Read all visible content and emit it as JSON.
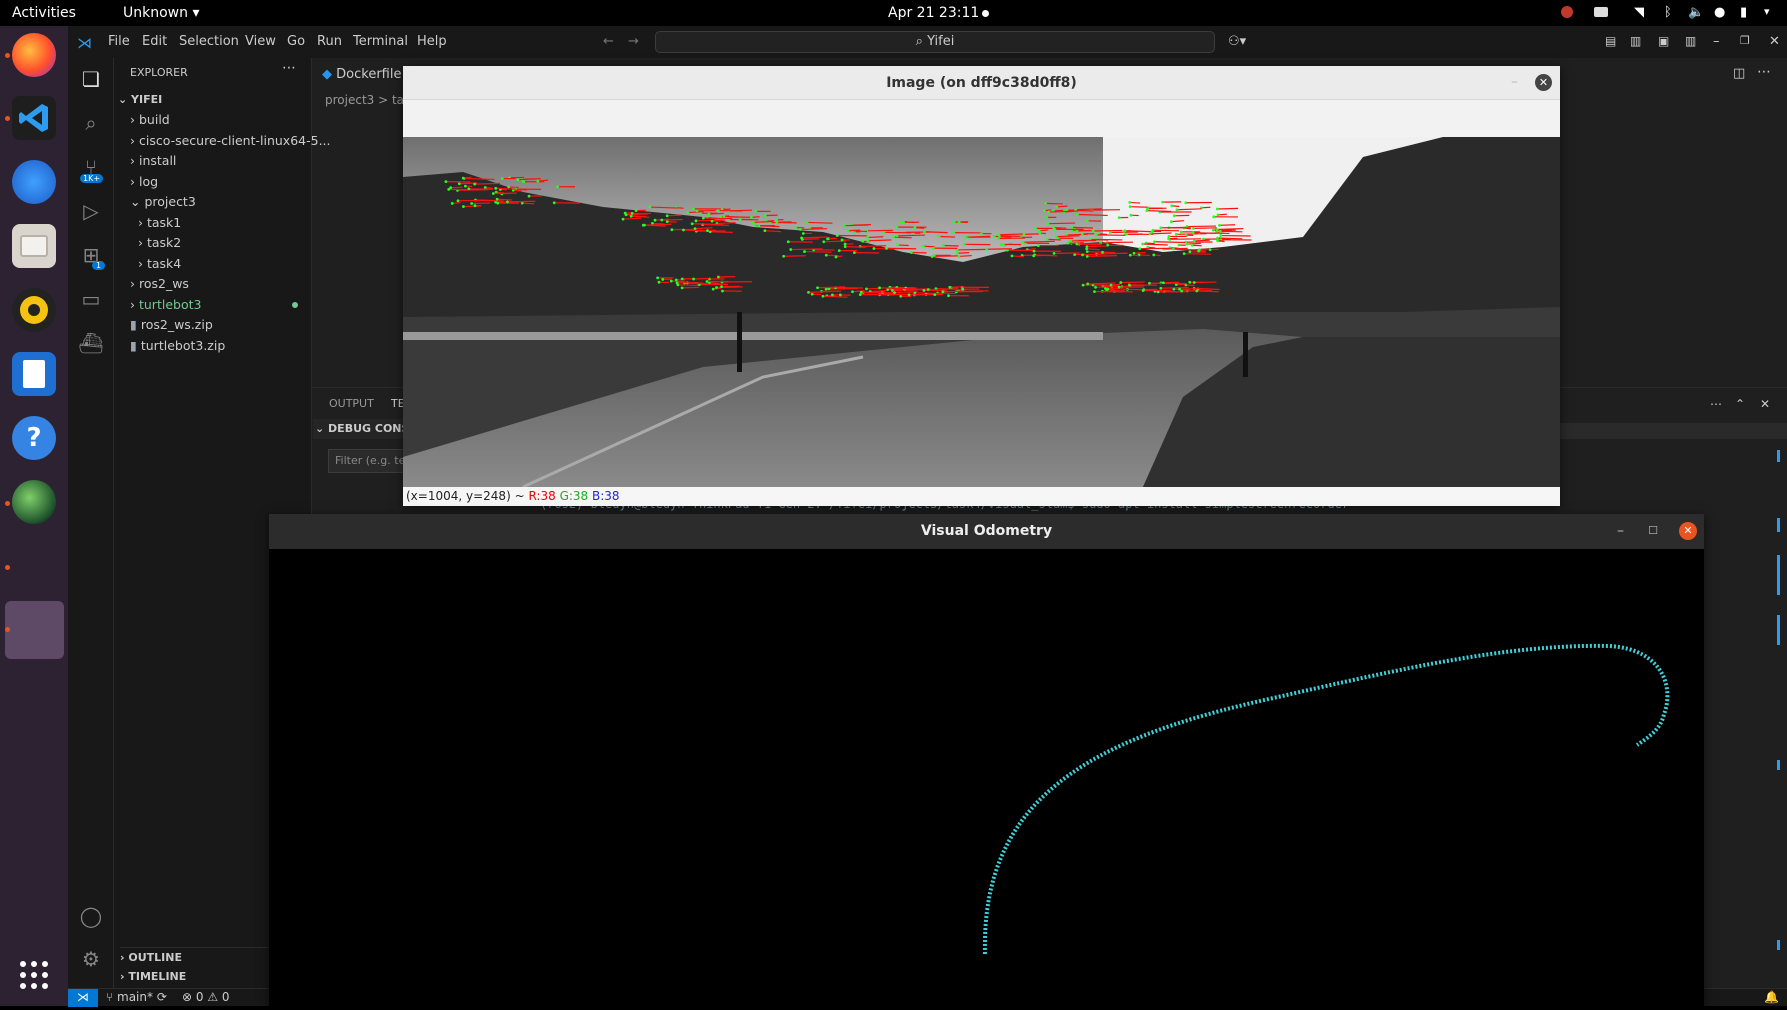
{
  "topbar": {
    "activities": "Activities",
    "app_menu": "Unknown",
    "clock": "Apr 21  23:11"
  },
  "vscode": {
    "menu": [
      "File",
      "Edit",
      "Selection",
      "View",
      "Go",
      "Run",
      "Terminal",
      "Help"
    ],
    "search": "Yifei",
    "explorer_title": "EXPLORER",
    "workspace": "YIFEI",
    "tree": [
      {
        "label": "build",
        "type": "folder",
        "indent": 1
      },
      {
        "label": "cisco-secure-client-linux64-5...",
        "type": "folder",
        "indent": 1
      },
      {
        "label": "install",
        "type": "folder",
        "indent": 1
      },
      {
        "label": "log",
        "type": "folder",
        "indent": 1
      },
      {
        "label": "project3",
        "type": "folder-open",
        "indent": 1
      },
      {
        "label": "task1",
        "type": "folder",
        "indent": 2
      },
      {
        "label": "task2",
        "type": "folder",
        "indent": 2
      },
      {
        "label": "task4",
        "type": "folder",
        "indent": 2
      },
      {
        "label": "ros2_ws",
        "type": "folder",
        "indent": 1
      },
      {
        "label": "turtlebot3",
        "type": "folder",
        "indent": 1,
        "modified": true
      },
      {
        "label": "ros2_ws.zip",
        "type": "file",
        "indent": 1
      },
      {
        "label": "turtlebot3.zip",
        "type": "file",
        "indent": 1
      }
    ],
    "editor_tab": "Dockerfile",
    "breadcrumb": "project3 > ta",
    "panel_tabs": [
      "OUTPUT",
      "TE"
    ],
    "debug_console": "DEBUG CONSO",
    "filter_placeholder": "Filter (e.g. te",
    "terminal_line": "(ros2) bledyn@bledyn-ThinkPad-T1-Gen-2:~/Yifei/project3/task4/visual_slam$ sudo apt install simplescreenrecorder",
    "outline": "OUTLINE",
    "timeline": "TIMELINE",
    "status_branch": "main*",
    "status_problems": "⊗ 0 ⚠ 0",
    "colors": {
      "accent": "#0078d4",
      "modified": "#73c991"
    }
  },
  "image_window": {
    "title": "Image (on dff9c38d0ff8)",
    "status_coords": "(x=1004, y=248) ~",
    "status_r": "R:38",
    "status_g": "G:38",
    "status_b": "B:38"
  },
  "vo_window": {
    "title": "Visual Odometry",
    "trajectory_color": "#3fd0d8"
  }
}
